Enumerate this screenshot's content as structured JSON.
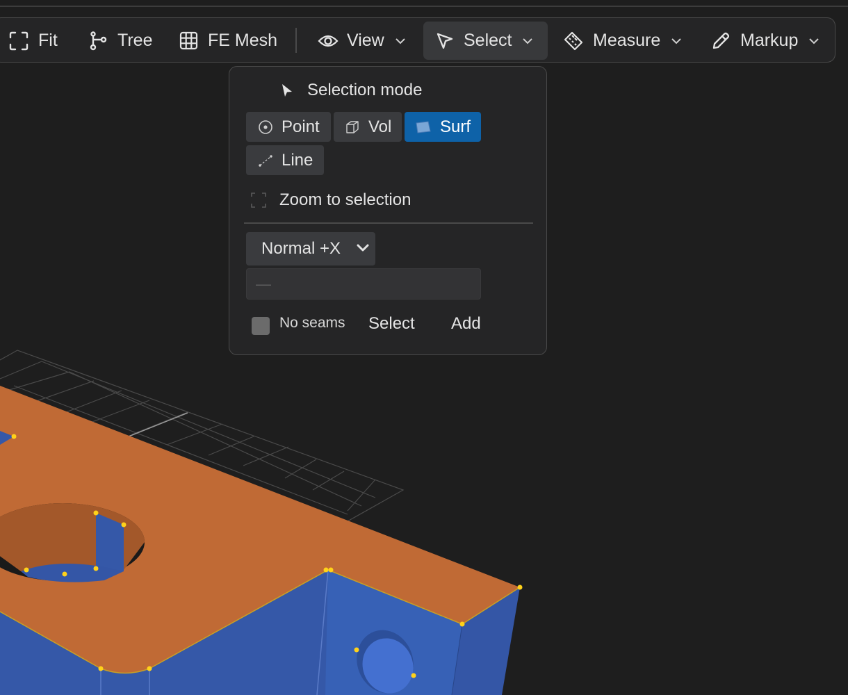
{
  "toolbar": {
    "fit": {
      "label": "Fit",
      "icon": "fit-icon"
    },
    "tree": {
      "label": "Tree",
      "icon": "tree-branch-icon"
    },
    "fe_mesh": {
      "label": "FE Mesh",
      "icon": "grid-icon"
    },
    "view": {
      "label": "View",
      "icon": "eye-icon"
    },
    "select": {
      "label": "Select",
      "icon": "cursor-arrow-icon",
      "active": true
    },
    "measure": {
      "label": "Measure",
      "icon": "ruler-icon"
    },
    "markup": {
      "label": "Markup",
      "icon": "pencil-icon"
    }
  },
  "select_menu": {
    "title": "Selection mode",
    "modes": [
      {
        "label": "Point",
        "icon": "point-icon",
        "selected": false
      },
      {
        "label": "Vol",
        "icon": "cube-icon",
        "selected": false
      },
      {
        "label": "Surf",
        "icon": "surface-icon",
        "selected": true
      },
      {
        "label": "Line",
        "icon": "line-icon",
        "selected": false
      }
    ],
    "zoom_to_selection": "Zoom to selection",
    "direction_value": "Normal +X",
    "direction_options": [
      "Normal +X"
    ],
    "input_placeholder": "—",
    "no_seams_label": "No seams",
    "no_seams_checked": false,
    "select_label": "Select",
    "add_label": "Add"
  },
  "colors": {
    "background": "#1e1e1e",
    "panel": "#252526",
    "accent": "#0e62a8",
    "model_top": "#c06a35",
    "model_side": "#3558a8",
    "vertex": "#ffd21a"
  }
}
